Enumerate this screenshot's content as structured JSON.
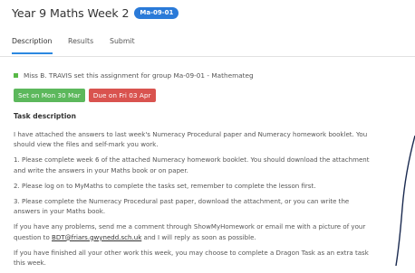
{
  "header": {
    "title": "Year 9 Maths Week 2",
    "badge": "Ma-09-01"
  },
  "tabs": [
    {
      "label": "Description",
      "active": true
    },
    {
      "label": "Results",
      "active": false
    },
    {
      "label": "Submit",
      "active": false
    }
  ],
  "assignment": {
    "teacher_line": "Miss B. TRAVIS set this assignment for group Ma-09-01 - Mathemateg",
    "set_label": "Set on Mon 30 Mar",
    "due_label": "Due on Fri 03 Apr",
    "status_color": "#58b947"
  },
  "task": {
    "heading": "Task description",
    "para1": "I have attached the answers to last week's Numeracy Procedural paper and Numeracy homework booklet. You should view the files and self-mark you work.",
    "para2": "1. Please complete week 6 of the attached Numeracy homework booklet. You should download the attachment and write the answers in your Maths book or on paper.",
    "para3": "2. Please log on to MyMaths to complete the tasks set, remember to complete the lesson first.",
    "para4": "3. Please complete the Numeracy Procedural past paper, download the attachment, or you can write the answers in your Maths book.",
    "para5_before": "If you have any problems, send me a comment through ShowMyHomework or email me with a picture of your question to ",
    "para5_link": "BDT@friars.gwynedd.sch.uk",
    "para5_after": " and I will reply as soon as possible.",
    "para6": "If you have finished all your other work this week, you may choose to complete a Dragon Task as an extra task this week."
  },
  "colors": {
    "accent": "#2b88e0",
    "badge_blue": "#2a7ad8",
    "set_green": "#5cb85c",
    "due_red": "#d9534f"
  }
}
